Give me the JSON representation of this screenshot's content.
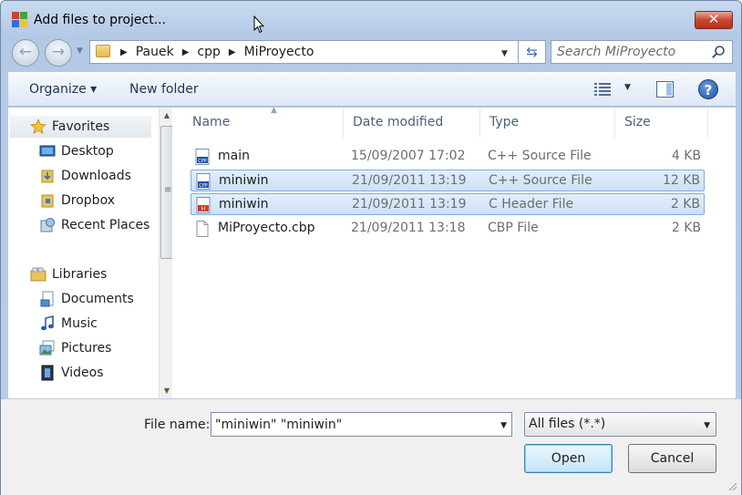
{
  "window": {
    "title": "Add files to project...",
    "close_label": "✕"
  },
  "navbar": {
    "breadcrumbs": [
      "Pauek",
      "cpp",
      "MiProyecto"
    ],
    "search_placeholder": "Search MiProyecto"
  },
  "toolbar": {
    "organize_label": "Organize ▾",
    "new_folder_label": "New folder",
    "help_label": "?"
  },
  "navpane": {
    "favorites": {
      "label": "Favorites",
      "icon": "star-icon"
    },
    "favorites_items": [
      {
        "label": "Desktop",
        "icon": "desktop-icon"
      },
      {
        "label": "Downloads",
        "icon": "downloads-folder-icon"
      },
      {
        "label": "Dropbox",
        "icon": "dropbox-folder-icon"
      },
      {
        "label": "Recent Places",
        "icon": "recent-places-icon"
      }
    ],
    "libraries": {
      "label": "Libraries",
      "icon": "libraries-icon"
    },
    "libraries_items": [
      {
        "label": "Documents",
        "icon": "documents-icon"
      },
      {
        "label": "Music",
        "icon": "music-icon"
      },
      {
        "label": "Pictures",
        "icon": "pictures-icon"
      },
      {
        "label": "Videos",
        "icon": "videos-icon"
      }
    ]
  },
  "filelist": {
    "columns": [
      "Name",
      "Date modified",
      "Type",
      "Size"
    ],
    "rows": [
      {
        "name": "main",
        "date": "15/09/2007 17:02",
        "type": "C++ Source File",
        "size": "4 KB",
        "icon": "cpp-file-icon",
        "selected": false
      },
      {
        "name": "miniwin",
        "date": "21/09/2011 13:19",
        "type": "C++ Source File",
        "size": "12 KB",
        "icon": "cpp-file-icon",
        "selected": true
      },
      {
        "name": "miniwin",
        "date": "21/09/2011 13:19",
        "type": "C Header File",
        "size": "2 KB",
        "icon": "h-file-icon",
        "selected": true
      },
      {
        "name": "MiProyecto.cbp",
        "date": "21/09/2011 13:18",
        "type": "CBP File",
        "size": "2 KB",
        "icon": "generic-file-icon",
        "selected": false
      }
    ]
  },
  "bottom": {
    "file_name_label": "File name:",
    "file_name_value": "\"miniwin\" \"miniwin\"",
    "file_type_value": "All files (*.*)",
    "open_label": "Open",
    "cancel_label": "Cancel"
  },
  "colors": {
    "accent": "#3c7fb1",
    "selection": "#cde0f7",
    "close_red": "#c8462d"
  }
}
